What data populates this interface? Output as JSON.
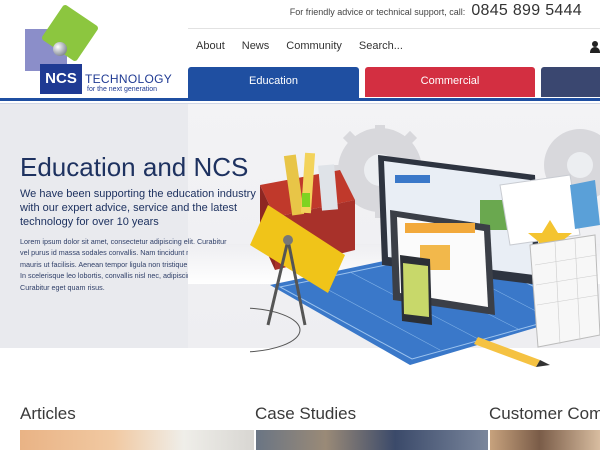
{
  "header": {
    "logo_text": "NCS",
    "logo_technology": "TECHNOLOGY",
    "logo_tagline": "for the next generation",
    "support_label": "For friendly advice or technical support, call:",
    "support_phone": "0845 899 5444"
  },
  "nav": {
    "items": [
      "About",
      "News",
      "Community",
      "Search..."
    ],
    "user_icon": "user-icon"
  },
  "tabs": [
    {
      "label": "Education",
      "color": "#1f4fa1",
      "active": true
    },
    {
      "label": "Commercial",
      "color": "#d32f41",
      "active": false
    },
    {
      "label": "",
      "color": "#3a4770",
      "active": false
    }
  ],
  "hero": {
    "title": "Education and NCS",
    "subtitle": "We have been supporting the education industry with our expert advice, service and the latest technology for over 10 years",
    "body": "Lorem ipsum dolor sit amet, consectetur adipiscing elit. Curabitur vel purus id massa sodales convallis. Nam tincidunt malesuada mauris ut facilisis. Aenean tempor ligula non tristique commodo. In scelerisque leo lobortis, convallis nisl nec, adipiscing erat. Curabitur eget quam risus."
  },
  "sections": [
    {
      "heading": "Articles"
    },
    {
      "heading": "Case Studies"
    },
    {
      "heading": "Customer Comm"
    }
  ],
  "colors": {
    "brand_blue": "#1f4fa1",
    "brand_red": "#d32f41",
    "brand_navy": "#1e3260",
    "logo_green": "#8cc63f",
    "logo_purple": "#8b8ec9"
  }
}
